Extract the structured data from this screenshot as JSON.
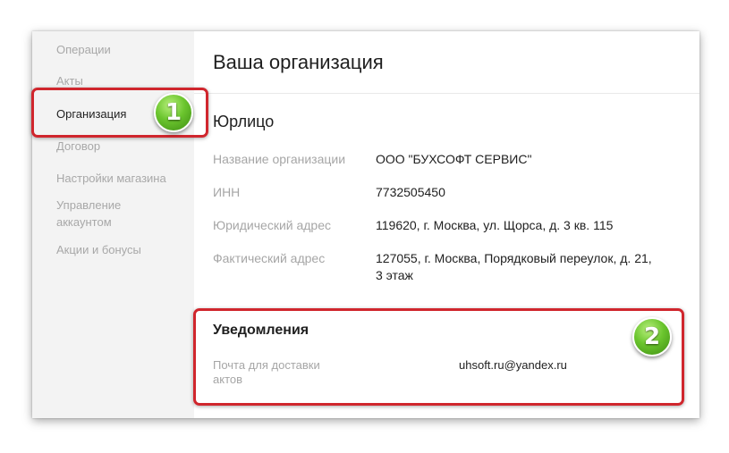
{
  "sidebar": {
    "items": [
      {
        "label": "Операции"
      },
      {
        "label": "Акты"
      },
      {
        "label": "Организация"
      },
      {
        "label": "Договор"
      },
      {
        "label": "Настройки магазина"
      },
      {
        "label": "Управление\nаккаунтом"
      },
      {
        "label": "Акции и бонусы"
      }
    ],
    "active_index": 2
  },
  "main": {
    "title": "Ваша организация",
    "legal_entity": {
      "heading": "Юрлицо",
      "rows": [
        {
          "label": "Название организации",
          "value": "ООО \"БУХСОФТ СЕРВИС\""
        },
        {
          "label": "ИНН",
          "value": "7732505450"
        },
        {
          "label": "Юридический адрес",
          "value": "119620, г. Москва, ул. Щорса, д. 3 кв. 115"
        },
        {
          "label": "Фактический адрес",
          "value": "127055, г. Москва, Порядковый переулок, д. 21,\n3 этаж"
        }
      ]
    },
    "notifications": {
      "heading": "Уведомления",
      "email_label": "Почта для доставки\nактов",
      "email_value": "uhsoft.ru@yandex.ru"
    }
  },
  "annotations": {
    "badge_1": "1",
    "badge_2": "2",
    "highlight_color": "#d0262d",
    "badge_color": "#6bc52e"
  }
}
